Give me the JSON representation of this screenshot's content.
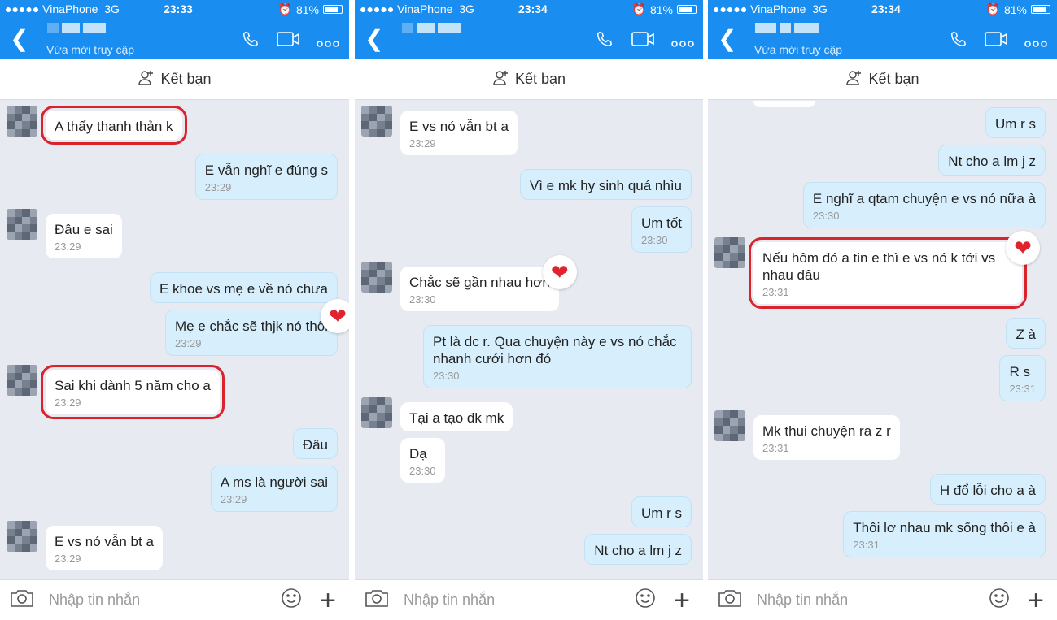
{
  "status_bar": {
    "carrier": "●●●●● VinaPhone",
    "network": "3G",
    "battery": "81%",
    "battery_level": 0.81
  },
  "colors": {
    "header": "#1a8df0",
    "outgoing_bubble": "#d7effd",
    "incoming_bubble": "#ffffff",
    "highlight": "#d9232d",
    "chat_bg": "#e7ebf1"
  },
  "panels": [
    {
      "time": "23:33",
      "contact_status": "Vừa mới truy cập",
      "add_friend": "Kết bạn",
      "input_placeholder": "Nhập tin nhắn",
      "messages": [
        {
          "side": "in",
          "avatar": true,
          "text": "A thấy thanh thản k",
          "time": "",
          "highlighted": true
        },
        {
          "side": "out",
          "text": "E vẫn nghĩ e đúng s",
          "time": "23:29"
        },
        {
          "side": "in",
          "avatar": true,
          "text": "Đâu e sai",
          "time": "23:29"
        },
        {
          "side": "out",
          "text": "E khoe vs mẹ e về nó chưa",
          "time": ""
        },
        {
          "side": "out",
          "text": "Mẹ e chắc sẽ thjk nó thôi",
          "time": "23:29",
          "reaction": "heart"
        },
        {
          "side": "in",
          "avatar": true,
          "text": "Sai khi dành 5 năm cho a",
          "time": "23:29",
          "highlighted": true
        },
        {
          "side": "out",
          "text": "Đâu",
          "time": ""
        },
        {
          "side": "out",
          "text": "A ms là người sai",
          "time": "23:29"
        },
        {
          "side": "in",
          "avatar": true,
          "text": "E vs nó vẫn bt a",
          "time": "23:29"
        }
      ]
    },
    {
      "time": "23:34",
      "contact_status": "",
      "add_friend": "Kết bạn",
      "input_placeholder": "Nhập tin nhắn",
      "messages": [
        {
          "side": "in",
          "avatar": true,
          "text": "E vs nó vẫn bt a",
          "time": "23:29"
        },
        {
          "side": "out",
          "text": "Vì e mk hy sinh quá nhìu",
          "time": ""
        },
        {
          "side": "out",
          "text": "Um tốt",
          "time": "23:30"
        },
        {
          "side": "in",
          "avatar": true,
          "text": "Chắc sẽ gần nhau hơn",
          "time": "23:30",
          "reaction": "heart"
        },
        {
          "side": "out",
          "text": "Pt là dc r. Qua chuyện này e vs nó chắc nhanh cưới hơn đó",
          "time": "23:30"
        },
        {
          "side": "in",
          "avatar": true,
          "text": "Tại a tạo đk mk",
          "time": ""
        },
        {
          "side": "in",
          "text": "Dạ",
          "time": "23:30"
        },
        {
          "side": "out",
          "text": "Um r s",
          "time": ""
        },
        {
          "side": "out",
          "text": "Nt cho a lm j z",
          "time": ""
        }
      ]
    },
    {
      "time": "23:34",
      "contact_status": "Vừa mới truy cập",
      "add_friend": "Kết bạn",
      "input_placeholder": "Nhập tin nhắn",
      "messages": [
        {
          "side": "out",
          "text": "Um r s",
          "time": ""
        },
        {
          "side": "out",
          "text": "Nt cho a lm j z",
          "time": ""
        },
        {
          "side": "out",
          "text": "E nghĩ a qtam chuyện e vs nó nữa à",
          "time": "23:30"
        },
        {
          "side": "in",
          "avatar": true,
          "text": "Nếu hôm đó a tin e thì e vs nó k tới vs nhau đâu",
          "time": "23:31",
          "highlighted": true,
          "reaction": "heart"
        },
        {
          "side": "out",
          "text": "Z à",
          "time": ""
        },
        {
          "side": "out",
          "text": "R s",
          "time": "23:31"
        },
        {
          "side": "in",
          "avatar": true,
          "text": "Mk thui chuyện ra z r",
          "time": "23:31"
        },
        {
          "side": "out",
          "text": "H đổ lỗi cho a à",
          "time": ""
        },
        {
          "side": "out",
          "text": "Thôi lơ nhau mk sống thôi e à",
          "time": "23:31"
        }
      ]
    }
  ]
}
